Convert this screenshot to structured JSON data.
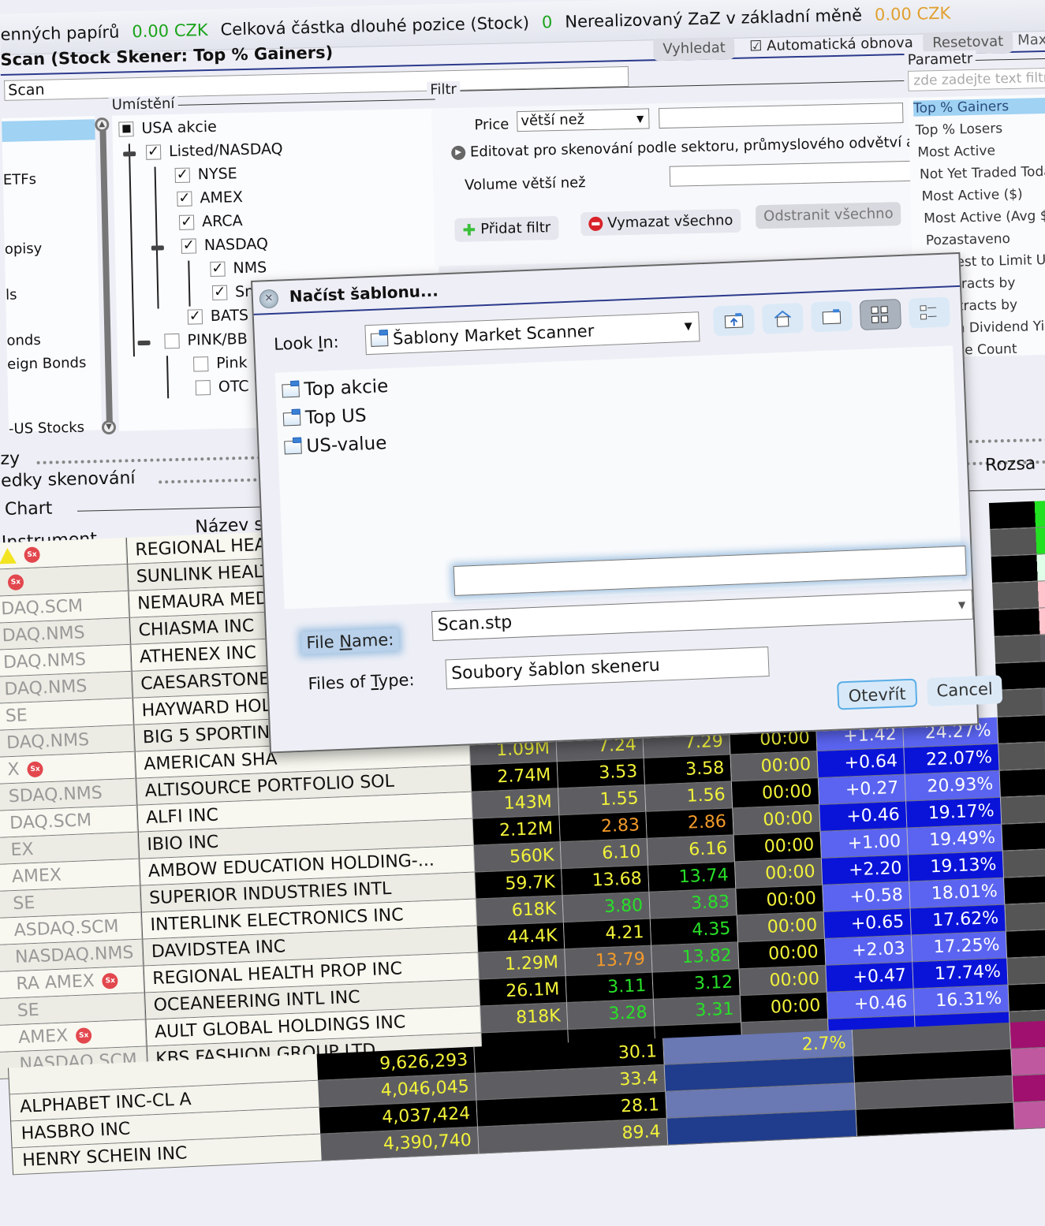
{
  "account_bar": {
    "label1": "enných papírů",
    "value1": "0.00 CZK",
    "label2": "Celková částka dlouhé pozice (Stock)",
    "value2": "0",
    "label3": "Nerealizovaný ZaZ v základní měně",
    "value3": "0.00 CZK"
  },
  "scan_panel": {
    "title": "Scan (Stock Skener: Top % Gainers)",
    "name_input_value": "Scan",
    "search_button": "Vyhledat",
    "auto_refresh_label": "Automatická obnova",
    "auto_refresh_checked": true,
    "reset_button": "Resetovat",
    "max_button": "Max",
    "instrument_list": [
      "",
      "ETFs",
      "opisy",
      "ls",
      "onds",
      "eign Bonds",
      "-US Stocks"
    ],
    "location": {
      "label": "Umístění",
      "tree": [
        {
          "label": "USA akcie",
          "state": "partial"
        },
        {
          "label": "Listed/NASDAQ",
          "state": "checked"
        },
        {
          "label": "NYSE",
          "state": "checked"
        },
        {
          "label": "AMEX",
          "state": "checked"
        },
        {
          "label": "ARCA",
          "state": "checked"
        },
        {
          "label": "NASDAQ",
          "state": "checked"
        },
        {
          "label": "NMS",
          "state": "checked"
        },
        {
          "label": "Small Cap",
          "state": "checked"
        },
        {
          "label": "BATS",
          "state": "checked"
        },
        {
          "label": "PINK/BB",
          "state": "unchecked"
        },
        {
          "label": "Pink",
          "state": "unchecked"
        },
        {
          "label": "OTC",
          "state": "unchecked"
        }
      ]
    },
    "filter": {
      "label": "Filtr",
      "price_label": "Price",
      "price_operator": "větší než",
      "price_value": "",
      "sector_edit_text": "Editovat pro skenování podle sektoru, průmyslového odvětví a",
      "volume_label": "Volume větší než",
      "volume_value": "",
      "add_filter_button": "Přidat filtr",
      "clear_all_button": "Vymazat všechno",
      "remove_all_button": "Odstranit všechno"
    },
    "parameter": {
      "label": "Parametr",
      "filter_placeholder": "zde zadejte text filtru",
      "items": [
        "Top % Gainers",
        "Top % Losers",
        "Most Active",
        "Not Yet Traded Today",
        "Most Active ($)",
        "Most Active (Avg $)",
        "Pozastaveno",
        "Closest to Limit Up/Down",
        "Contracts by",
        "Contracts by",
        "High Dividend Yield",
        "Trade Count"
      ],
      "selected_index": 0
    }
  },
  "sections": {
    "section1": "zy",
    "section2": "edky skenování",
    "chart_label": "Chart"
  },
  "scanner_table": {
    "headers": {
      "instrument": "Instrument",
      "name": "Název s",
      "range": "Rozsa"
    },
    "rows": [
      {
        "instr": "",
        "badges": [
          "warning",
          "sx"
        ],
        "name": "REGIONAL HEAL",
        "vol": "",
        "bid": "",
        "ask": "",
        "time": "",
        "chg": "",
        "pct": ""
      },
      {
        "instr": "",
        "badges": [
          "sx"
        ],
        "name": "SUNLINK HEALT",
        "vol": "",
        "bid": "",
        "ask": "",
        "time": "",
        "chg": "",
        "pct": ""
      },
      {
        "instr": "DAQ.SCM",
        "badges": [],
        "name": "NEMAURA MED",
        "vol": "",
        "bid": "",
        "ask": "",
        "time": "",
        "chg": "",
        "pct": ""
      },
      {
        "instr": "DAQ.NMS",
        "badges": [],
        "name": "CHIASMA INC",
        "vol": "",
        "bid": "",
        "ask": "",
        "time": "",
        "chg": "",
        "pct": ""
      },
      {
        "instr": "DAQ.NMS",
        "badges": [],
        "name": "ATHENEX INC",
        "vol": "",
        "bid": "",
        "ask": "",
        "time": "",
        "chg": "",
        "pct": ""
      },
      {
        "instr": "DAQ.NMS",
        "badges": [],
        "name": "CAESARSTONE",
        "vol": "",
        "bid": "",
        "ask": "",
        "time": "",
        "chg": "",
        "pct": ""
      },
      {
        "instr": "SE",
        "badges": [],
        "name": "HAYWARD HOL",
        "vol": "",
        "bid": "",
        "ask": "",
        "time": "",
        "chg": "",
        "pct": ""
      },
      {
        "instr": "DAQ.NMS",
        "badges": [],
        "name": "BIG 5 SPORTING",
        "vol": "",
        "bid": "",
        "ask": "",
        "time": "",
        "chg": "",
        "pct": ""
      },
      {
        "instr": "X",
        "badges": [
          "sx"
        ],
        "name": "AMERICAN SHA",
        "vol": "1.09M",
        "bid": "7.24",
        "ask": "7.29",
        "time": "00:00",
        "chg": "+1.42",
        "pct": "24.27%"
      },
      {
        "instr": "SDAQ.NMS",
        "badges": [],
        "name": "ALTISOURCE PORTFOLIO SOL",
        "vol": "2.74M",
        "bid": "3.53",
        "ask": "3.58",
        "time": "00:00",
        "chg": "+0.64",
        "pct": "22.07%"
      },
      {
        "instr": "DAQ.SCM",
        "badges": [],
        "name": "ALFI INC",
        "vol": "143M",
        "bid": "1.55",
        "ask": "1.56",
        "time": "00:00",
        "chg": "+0.27",
        "pct": "20.93%"
      },
      {
        "instr": "EX",
        "badges": [],
        "name": "IBIO INC",
        "vol": "2.12M",
        "bid": "2.83",
        "ask": "2.86",
        "time": "00:00",
        "chg": "+0.46",
        "pct": "19.17%"
      },
      {
        "instr": "AMEX",
        "badges": [],
        "name": "AMBOW EDUCATION HOLDING-...",
        "vol": "560K",
        "bid": "6.10",
        "ask": "6.16",
        "time": "00:00",
        "chg": "+1.00",
        "pct": "19.49%"
      },
      {
        "instr": "SE",
        "badges": [],
        "name": "SUPERIOR INDUSTRIES INTL",
        "vol": "59.7K",
        "bid": "13.68",
        "ask": "13.74",
        "time": "00:00",
        "chg": "+2.20",
        "pct": "19.13%"
      },
      {
        "instr": "ASDAQ.SCM",
        "badges": [],
        "name": "INTERLINK ELECTRONICS INC",
        "vol": "618K",
        "bid": "3.80",
        "ask": "3.83",
        "time": "00:00",
        "chg": "+0.58",
        "pct": "18.01%"
      },
      {
        "instr": "NASDAQ.NMS",
        "badges": [],
        "name": "DAVIDSTEA INC",
        "vol": "44.4K",
        "bid": "4.21",
        "ask": "4.35",
        "time": "00:00",
        "chg": "+0.65",
        "pct": "17.62%"
      },
      {
        "instr": "RA AMEX",
        "badges": [
          "sx"
        ],
        "name": "REGIONAL HEALTH PROP INC",
        "vol": "1.29M",
        "bid": "13.79",
        "ask": "13.82",
        "time": "00:00",
        "chg": "+2.03",
        "pct": "17.25%"
      },
      {
        "instr": "SE",
        "badges": [],
        "name": "OCEANEERING INTL INC",
        "vol": "26.1M",
        "bid": "3.11",
        "ask": "3.12",
        "time": "00:00",
        "chg": "+0.47",
        "pct": "17.74%"
      },
      {
        "instr": "AMEX",
        "badges": [
          "sx"
        ],
        "name": "AULT GLOBAL HOLDINGS INC",
        "vol": "818K",
        "bid": "3.28",
        "ask": "3.31",
        "time": "00:00",
        "chg": "+0.46",
        "pct": "16.31%"
      },
      {
        "instr": "NASDAQ.SCM",
        "badges": [],
        "name": "KBS FASHION GROUP LTD",
        "vol": "",
        "bid": "",
        "ask": "",
        "time": "",
        "chg": "",
        "pct": ""
      }
    ]
  },
  "bottom_table": {
    "rows": [
      {
        "name": "",
        "vol": "9,626,293",
        "val": "30.1",
        "pct": "2.7%"
      },
      {
        "name": "ALPHABET INC-CL A",
        "vol": "4,046,045",
        "val": "33.4",
        "pct": ""
      },
      {
        "name": "HASBRO INC",
        "vol": "4,037,424",
        "val": "28.1",
        "pct": ""
      },
      {
        "name": "HENRY SCHEIN INC",
        "vol": "4,390,740",
        "val": "89.4",
        "pct": ""
      }
    ]
  },
  "dialog": {
    "title": "Načíst šablonu...",
    "look_in_label": "Look In:",
    "look_in_value": "Šablony Market Scanner",
    "toolbar_icons": [
      "up-folder-icon",
      "home-icon",
      "new-folder-icon",
      "list-view-icon",
      "details-view-icon"
    ],
    "files": [
      "Top akcie",
      "Top US",
      "US-value"
    ],
    "file_name_label": "File Name:",
    "file_name_value": "Scan.stp",
    "files_of_type_label": "Files of Type:",
    "files_of_type_value": "Soubory šablon skeneru",
    "open_button": "Otevřít",
    "cancel_button": "Cancel"
  }
}
